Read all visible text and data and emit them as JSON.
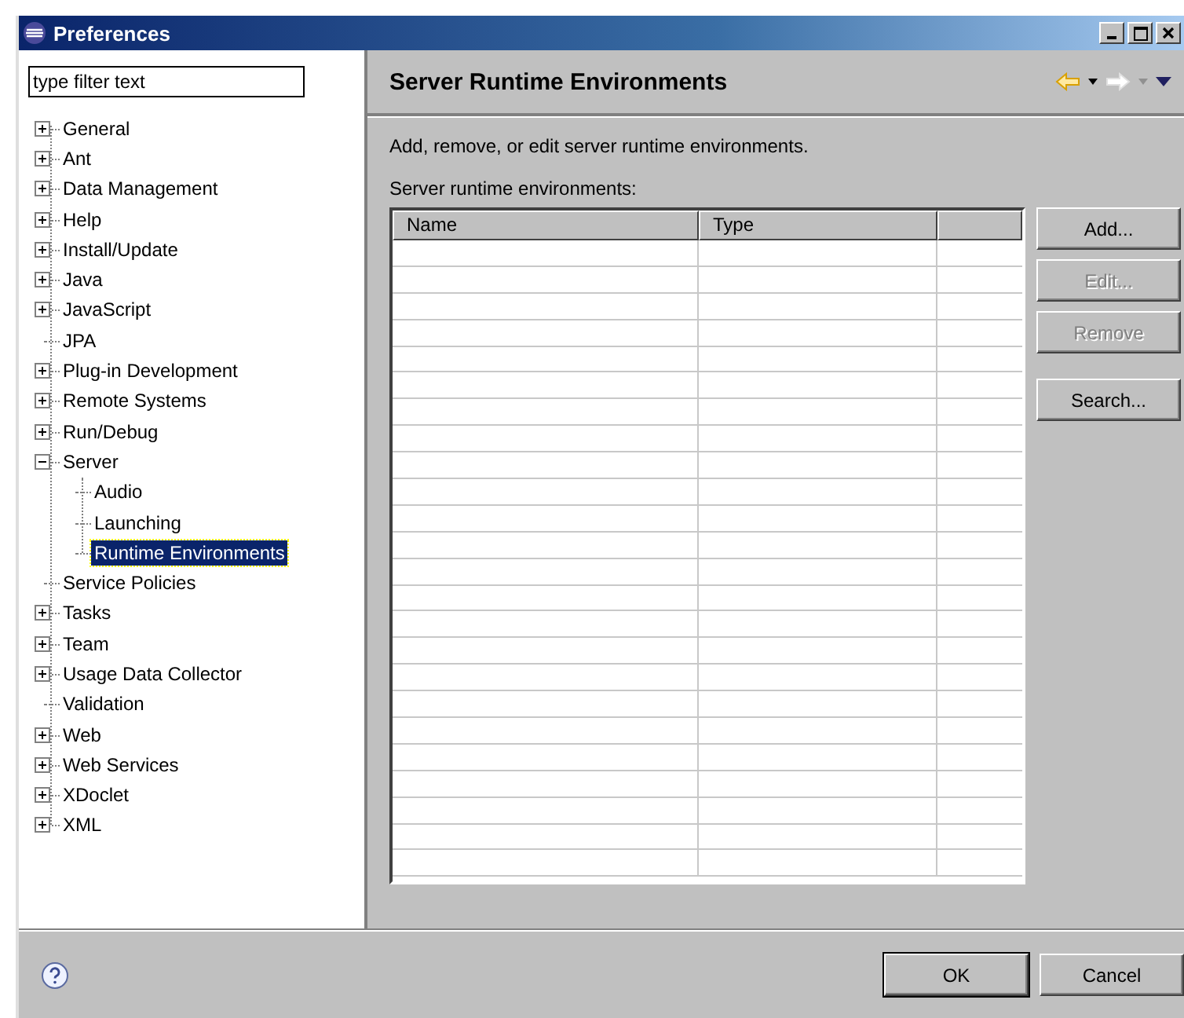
{
  "window": {
    "title": "Preferences"
  },
  "filter": {
    "placeholder": "type filter text"
  },
  "tree": [
    {
      "label": "General",
      "expanded": false,
      "selected": false
    },
    {
      "label": "Ant",
      "expanded": false,
      "selected": false
    },
    {
      "label": "Data Management",
      "expanded": false,
      "selected": false
    },
    {
      "label": "Help",
      "expanded": false,
      "selected": false
    },
    {
      "label": "Install/Update",
      "expanded": false,
      "selected": false
    },
    {
      "label": "Java",
      "expanded": false,
      "selected": false
    },
    {
      "label": "JavaScript",
      "expanded": false,
      "selected": false
    },
    {
      "label": "JPA",
      "selected": false
    },
    {
      "label": "Plug-in Development",
      "expanded": false,
      "selected": false
    },
    {
      "label": "Remote Systems",
      "expanded": false,
      "selected": false
    },
    {
      "label": "Run/Debug",
      "expanded": false,
      "selected": false
    },
    {
      "label": "Server",
      "expanded": true,
      "selected": false,
      "children": [
        {
          "label": "Audio",
          "selected": false
        },
        {
          "label": "Launching",
          "selected": false
        },
        {
          "label": "Runtime Environments",
          "selected": true
        }
      ]
    },
    {
      "label": "Service Policies",
      "selected": false
    },
    {
      "label": "Tasks",
      "expanded": false,
      "selected": false
    },
    {
      "label": "Team",
      "expanded": false,
      "selected": false
    },
    {
      "label": "Usage Data Collector",
      "expanded": false,
      "selected": false
    },
    {
      "label": "Validation",
      "selected": false
    },
    {
      "label": "Web",
      "expanded": false,
      "selected": false
    },
    {
      "label": "Web Services",
      "expanded": false,
      "selected": false
    },
    {
      "label": "XDoclet",
      "expanded": false,
      "selected": false
    },
    {
      "label": "XML",
      "expanded": false,
      "selected": false
    }
  ],
  "page": {
    "title": "Server Runtime Environments",
    "description": "Add, remove, or edit server runtime environments.",
    "table_label": "Server runtime environments:",
    "table": {
      "columns": [
        "Name",
        "Type"
      ]
    },
    "buttons": [
      {
        "label": "Add...",
        "disabled": false
      },
      {
        "label": "Edit...",
        "disabled": true
      },
      {
        "label": "Remove",
        "disabled": true
      },
      {
        "label": "Search...",
        "disabled": false
      }
    ]
  },
  "footer": {
    "buttons": [
      "OK",
      "Cancel"
    ]
  }
}
